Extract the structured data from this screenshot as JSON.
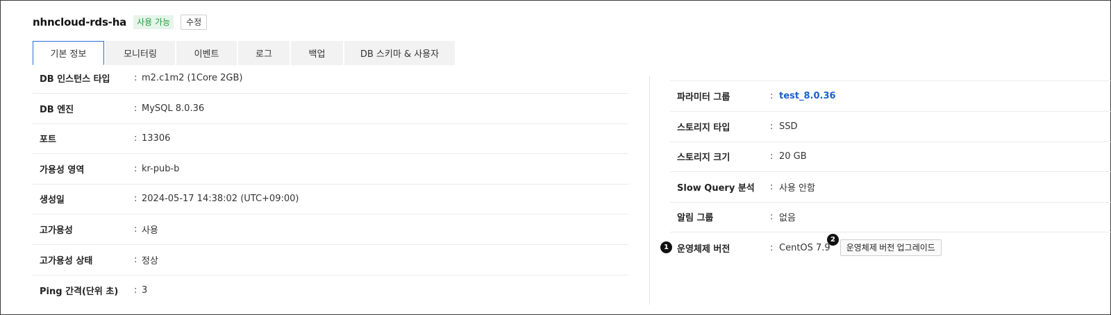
{
  "header": {
    "title": "nhncloud-rds-ha",
    "status_badge": "사용 가능",
    "edit_label": "수정"
  },
  "tabs": [
    {
      "label": "기본 정보",
      "active": true
    },
    {
      "label": "모니터링"
    },
    {
      "label": "이벤트"
    },
    {
      "label": "로그"
    },
    {
      "label": "백업"
    },
    {
      "label": "DB 스키마 & 사용자"
    }
  ],
  "left_fields": [
    {
      "label": "DB 인스턴스 타입",
      "value": "m2.c1m2 (1Core 2GB)"
    },
    {
      "label": "DB 엔진",
      "value": "MySQL 8.0.36"
    },
    {
      "label": "포트",
      "value": "13306"
    },
    {
      "label": "가용성 영역",
      "value": "kr-pub-b"
    },
    {
      "label": "생성일",
      "value": "2024-05-17 14:38:02 (UTC+09:00)"
    },
    {
      "label": "고가용성",
      "value": "사용"
    },
    {
      "label": "고가용성 상태",
      "value": "정상"
    },
    {
      "label": "Ping 간격(단위 초)",
      "value": "3"
    }
  ],
  "right_fields": [
    {
      "label": "파라미터 그룹",
      "value": "test_8.0.36"
    },
    {
      "label": "스토리지 타입",
      "value": "SSD"
    },
    {
      "label": "스토리지 크기",
      "value": "20 GB"
    },
    {
      "label": "Slow Query 분석",
      "value": "사용 안함"
    },
    {
      "label": "알림 그룹",
      "value": "없음"
    },
    {
      "label": "운영체제 버전",
      "value": "CentOS 7.9"
    }
  ],
  "separator": ":",
  "os_upgrade_button": "운영체제 버전 업그레이드",
  "markers": [
    "1",
    "2"
  ],
  "colors": {
    "accent_blue": "#2a6cd6",
    "link_blue": "#1a5fcf",
    "badge_green": "#1f9e3a",
    "badge_bg": "#e6f5e9"
  }
}
